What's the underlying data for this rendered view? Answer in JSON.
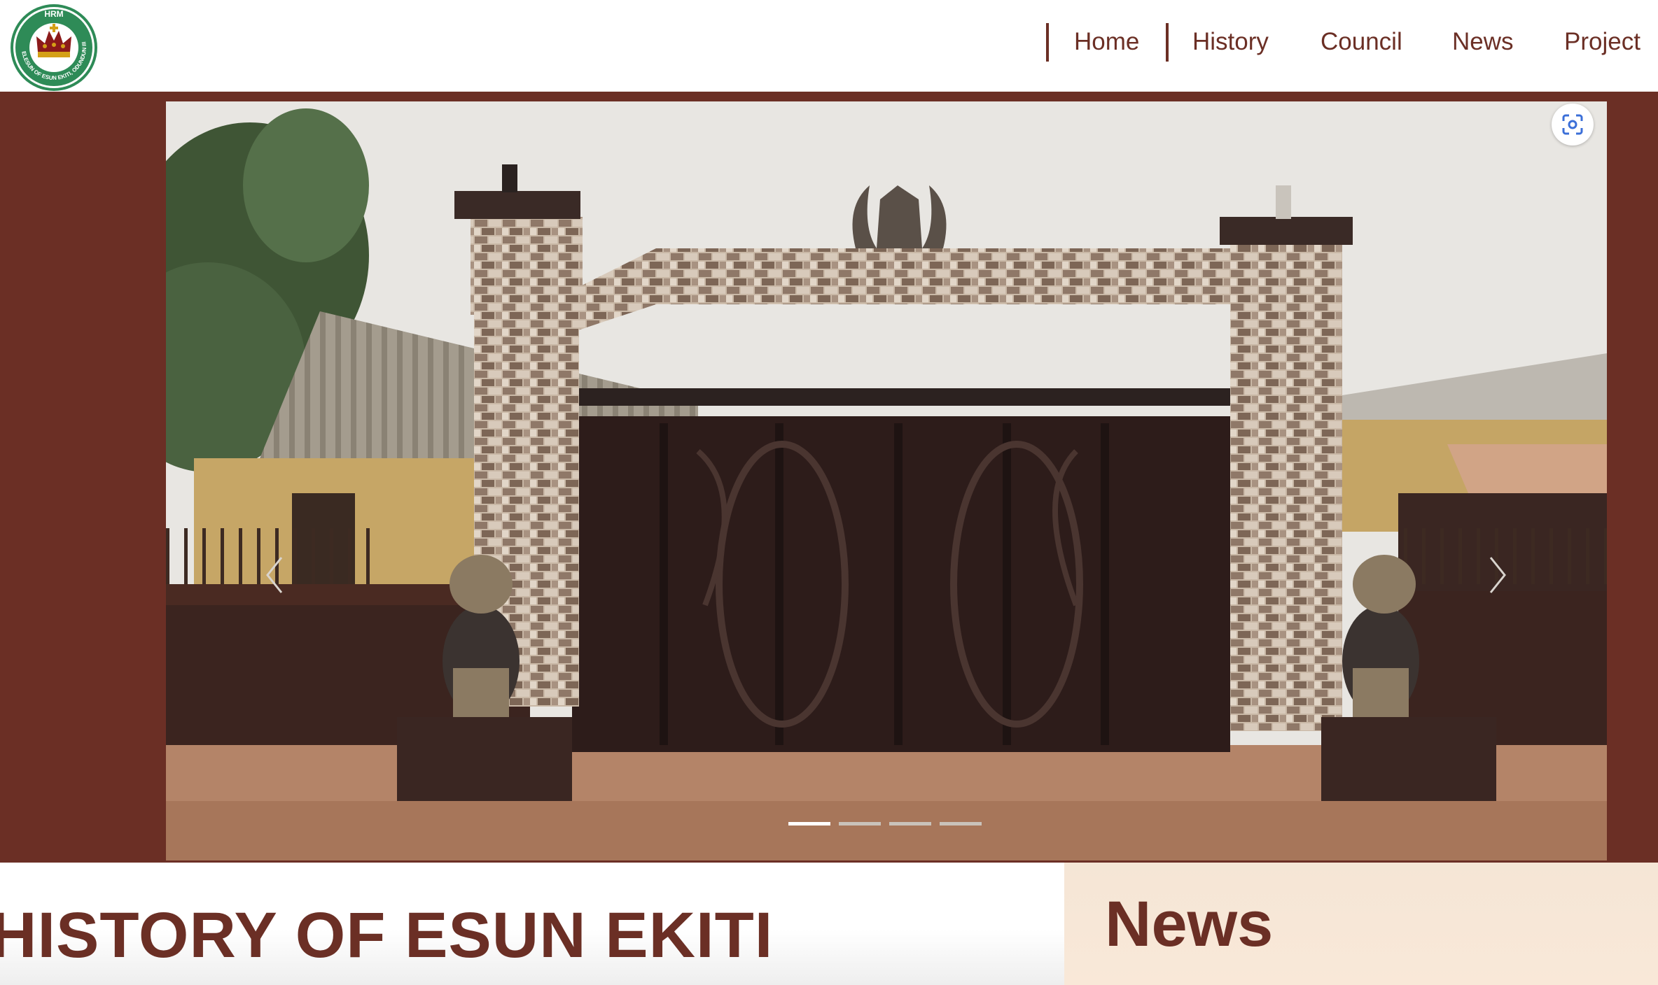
{
  "logo": {
    "top_text": "HRM",
    "ring_text": "ELESUN OF ESUN EKITI, ODUNDUN III",
    "colors": {
      "ring": "#2e8b57",
      "crown": "#8b1a1a"
    }
  },
  "nav": {
    "items": [
      {
        "label": "Home"
      },
      {
        "label": "History"
      },
      {
        "label": "Council"
      },
      {
        "label": "News"
      },
      {
        "label": "Project"
      }
    ]
  },
  "carousel": {
    "slide_count": 4,
    "active_index": 0,
    "image_description_icon": "lens-icon",
    "prev_icon": "chevron-left-icon",
    "next_icon": "chevron-right-icon"
  },
  "sections": {
    "history_title": "HISTORY OF ESUN EKITI",
    "news_title": "News"
  },
  "colors": {
    "brand": "#6b2f25",
    "news_panel": "#f7e7d7"
  }
}
